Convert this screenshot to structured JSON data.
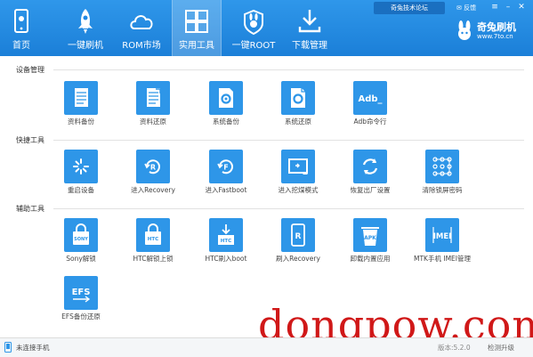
{
  "header": {
    "forum_link": "奇兔技术论坛",
    "feedback": "反馈",
    "nav": [
      {
        "label": "首页",
        "icon": "phone-icon"
      },
      {
        "label": "一键刷机",
        "icon": "rocket-icon"
      },
      {
        "label": "ROM市场",
        "icon": "cloud-icon"
      },
      {
        "label": "实用工具",
        "icon": "tools-grid-icon"
      },
      {
        "label": "一键ROOT",
        "icon": "rabbit-shield-icon"
      },
      {
        "label": "下载管理",
        "icon": "download-icon"
      }
    ],
    "active_tab": "实用工具",
    "brand": {
      "name": "奇兔刷机",
      "url": "www.7to.cn"
    }
  },
  "sections": [
    {
      "title": "设备管理",
      "tools": [
        {
          "label": "资料备份",
          "icon": "document-icon"
        },
        {
          "label": "资料还原",
          "icon": "document-restore-icon"
        },
        {
          "label": "系统备份",
          "icon": "system-gear-icon"
        },
        {
          "label": "系统还原",
          "icon": "system-restore-icon"
        },
        {
          "label": "Adb命令行",
          "icon": "adb-terminal-icon",
          "tile_text": "Adb_"
        }
      ]
    },
    {
      "title": "快捷工具",
      "tools": [
        {
          "label": "重启设备",
          "icon": "spinner-icon"
        },
        {
          "label": "进入Recovery",
          "icon": "recovery-icon",
          "tile_text": "R"
        },
        {
          "label": "进入Fastboot",
          "icon": "fastboot-icon",
          "tile_text": "F"
        },
        {
          "label": "进入挖煤模式",
          "icon": "screen-mode-icon"
        },
        {
          "label": "恢复出厂设置",
          "icon": "refresh-icon"
        },
        {
          "label": "清除锁屏密码",
          "icon": "pattern-lock-icon"
        }
      ]
    },
    {
      "title": "辅助工具",
      "tools": [
        {
          "label": "Sony解锁",
          "icon": "lock-sony-icon",
          "tile_text": "SONY"
        },
        {
          "label": "HTC解锁上锁",
          "icon": "lock-htc-icon",
          "tile_text": "HTC"
        },
        {
          "label": "HTC刷入boot",
          "icon": "htc-download-icon",
          "tile_text": "HTC"
        },
        {
          "label": "刷入Recovery",
          "icon": "phone-recovery-icon",
          "tile_text": "R"
        },
        {
          "label": "卸载内置应用",
          "icon": "apk-trash-icon",
          "tile_text": "APK"
        },
        {
          "label": "MTK手机 IMEI管理",
          "icon": "imei-icon",
          "tile_text": "IMEI"
        },
        {
          "label": "EFS备份还原",
          "icon": "efs-icon",
          "tile_text": "EFS"
        }
      ]
    }
  ],
  "footer": {
    "status": "未连接手机",
    "version": "版本:5.2.0",
    "upgrade": "检测升级"
  },
  "watermark": "dongpow.com",
  "colors": {
    "header": "#1e88e5",
    "tile": "#2e96e8",
    "watermark": "#d01818"
  }
}
